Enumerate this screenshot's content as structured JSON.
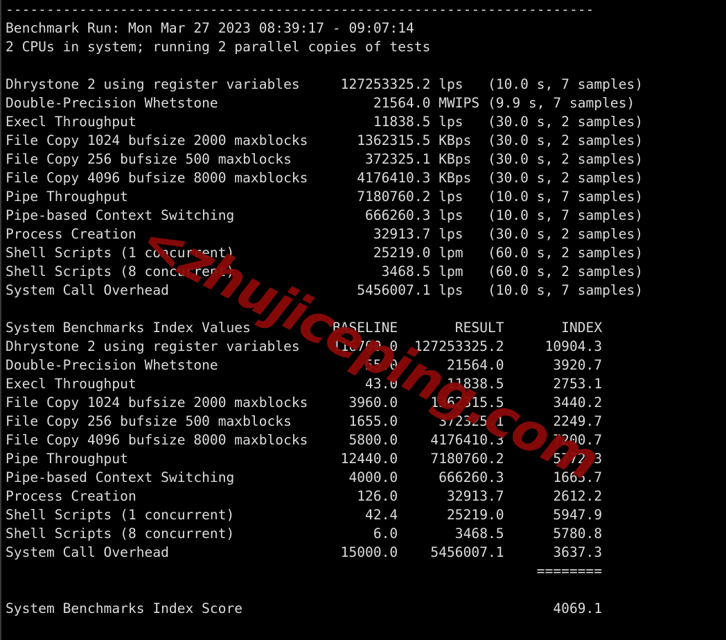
{
  "terminal": {
    "background_color": "#000000",
    "text_color": "#dcdcdc",
    "separator_top": "------------------------------------------------------------------------",
    "header": {
      "benchmark_run_label": "Benchmark Run:",
      "benchmark_run_value": "Mon Mar 27 2023 08:39:17 - 09:07:14",
      "benchmark_run_line": "Benchmark Run: Mon Mar 27 2023 08:39:17 - 09:07:14",
      "cpu_line": "2 CPUs in system; running 2 parallel copies of tests",
      "cpu_count": "2",
      "parallel_copies": "2"
    },
    "raw_results": {
      "rows": [
        {
          "name": "Dhrystone 2 using register variables",
          "value": "127253325.2",
          "unit": "lps",
          "timing": "(10.0 s, 7 samples)"
        },
        {
          "name": "Double-Precision Whetstone",
          "value": "21564.0",
          "unit": "MWIPS",
          "timing": "(9.9 s, 7 samples)"
        },
        {
          "name": "Execl Throughput",
          "value": "11838.5",
          "unit": "lps",
          "timing": "(30.0 s, 2 samples)"
        },
        {
          "name": "File Copy 1024 bufsize 2000 maxblocks",
          "value": "1362315.5",
          "unit": "KBps",
          "timing": "(30.0 s, 2 samples)"
        },
        {
          "name": "File Copy 256 bufsize 500 maxblocks",
          "value": "372325.1",
          "unit": "KBps",
          "timing": "(30.0 s, 2 samples)"
        },
        {
          "name": "File Copy 4096 bufsize 8000 maxblocks",
          "value": "4176410.3",
          "unit": "KBps",
          "timing": "(30.0 s, 2 samples)"
        },
        {
          "name": "Pipe Throughput",
          "value": "7180760.2",
          "unit": "lps",
          "timing": "(10.0 s, 7 samples)"
        },
        {
          "name": "Pipe-based Context Switching",
          "value": "666260.3",
          "unit": "lps",
          "timing": "(10.0 s, 7 samples)"
        },
        {
          "name": "Process Creation",
          "value": "32913.7",
          "unit": "lps",
          "timing": "(30.0 s, 2 samples)"
        },
        {
          "name": "Shell Scripts (1 concurrent)",
          "value": "25219.0",
          "unit": "lpm",
          "timing": "(60.0 s, 2 samples)"
        },
        {
          "name": "Shell Scripts (8 concurrent)",
          "value": "3468.5",
          "unit": "lpm",
          "timing": "(60.0 s, 2 samples)"
        },
        {
          "name": "System Call Overhead",
          "value": "5456007.1",
          "unit": "lps",
          "timing": "(10.0 s, 7 samples)"
        }
      ]
    },
    "index_table": {
      "title": "System Benchmarks Index Values",
      "columns": [
        "BASELINE",
        "RESULT",
        "INDEX"
      ],
      "rows": [
        {
          "name": "Dhrystone 2 using register variables",
          "baseline": "116700.0",
          "result": "127253325.2",
          "index": "10904.3"
        },
        {
          "name": "Double-Precision Whetstone",
          "baseline": "55.0",
          "result": "21564.0",
          "index": "3920.7"
        },
        {
          "name": "Execl Throughput",
          "baseline": "43.0",
          "result": "11838.5",
          "index": "2753.1"
        },
        {
          "name": "File Copy 1024 bufsize 2000 maxblocks",
          "baseline": "3960.0",
          "result": "1362315.5",
          "index": "3440.2"
        },
        {
          "name": "File Copy 256 bufsize 500 maxblocks",
          "baseline": "1655.0",
          "result": "372325.1",
          "index": "2249.7"
        },
        {
          "name": "File Copy 4096 bufsize 8000 maxblocks",
          "baseline": "5800.0",
          "result": "4176410.3",
          "index": "7200.7"
        },
        {
          "name": "Pipe Throughput",
          "baseline": "12440.0",
          "result": "7180760.2",
          "index": "5772.3"
        },
        {
          "name": "Pipe-based Context Switching",
          "baseline": "4000.0",
          "result": "666260.3",
          "index": "1665.7"
        },
        {
          "name": "Process Creation",
          "baseline": "126.0",
          "result": "32913.7",
          "index": "2612.2"
        },
        {
          "name": "Shell Scripts (1 concurrent)",
          "baseline": "42.4",
          "result": "25219.0",
          "index": "5947.9"
        },
        {
          "name": "Shell Scripts (8 concurrent)",
          "baseline": "6.0",
          "result": "3468.5",
          "index": "5780.8"
        },
        {
          "name": "System Call Overhead",
          "baseline": "15000.0",
          "result": "5456007.1",
          "index": "3637.3"
        }
      ],
      "equals_separator": "========",
      "score_label": "System Benchmarks Index Score",
      "score_value": "4069.1"
    }
  },
  "watermark": {
    "text": "zhujiceping.com",
    "prefix": "<",
    "color": "#8B0A0A"
  }
}
